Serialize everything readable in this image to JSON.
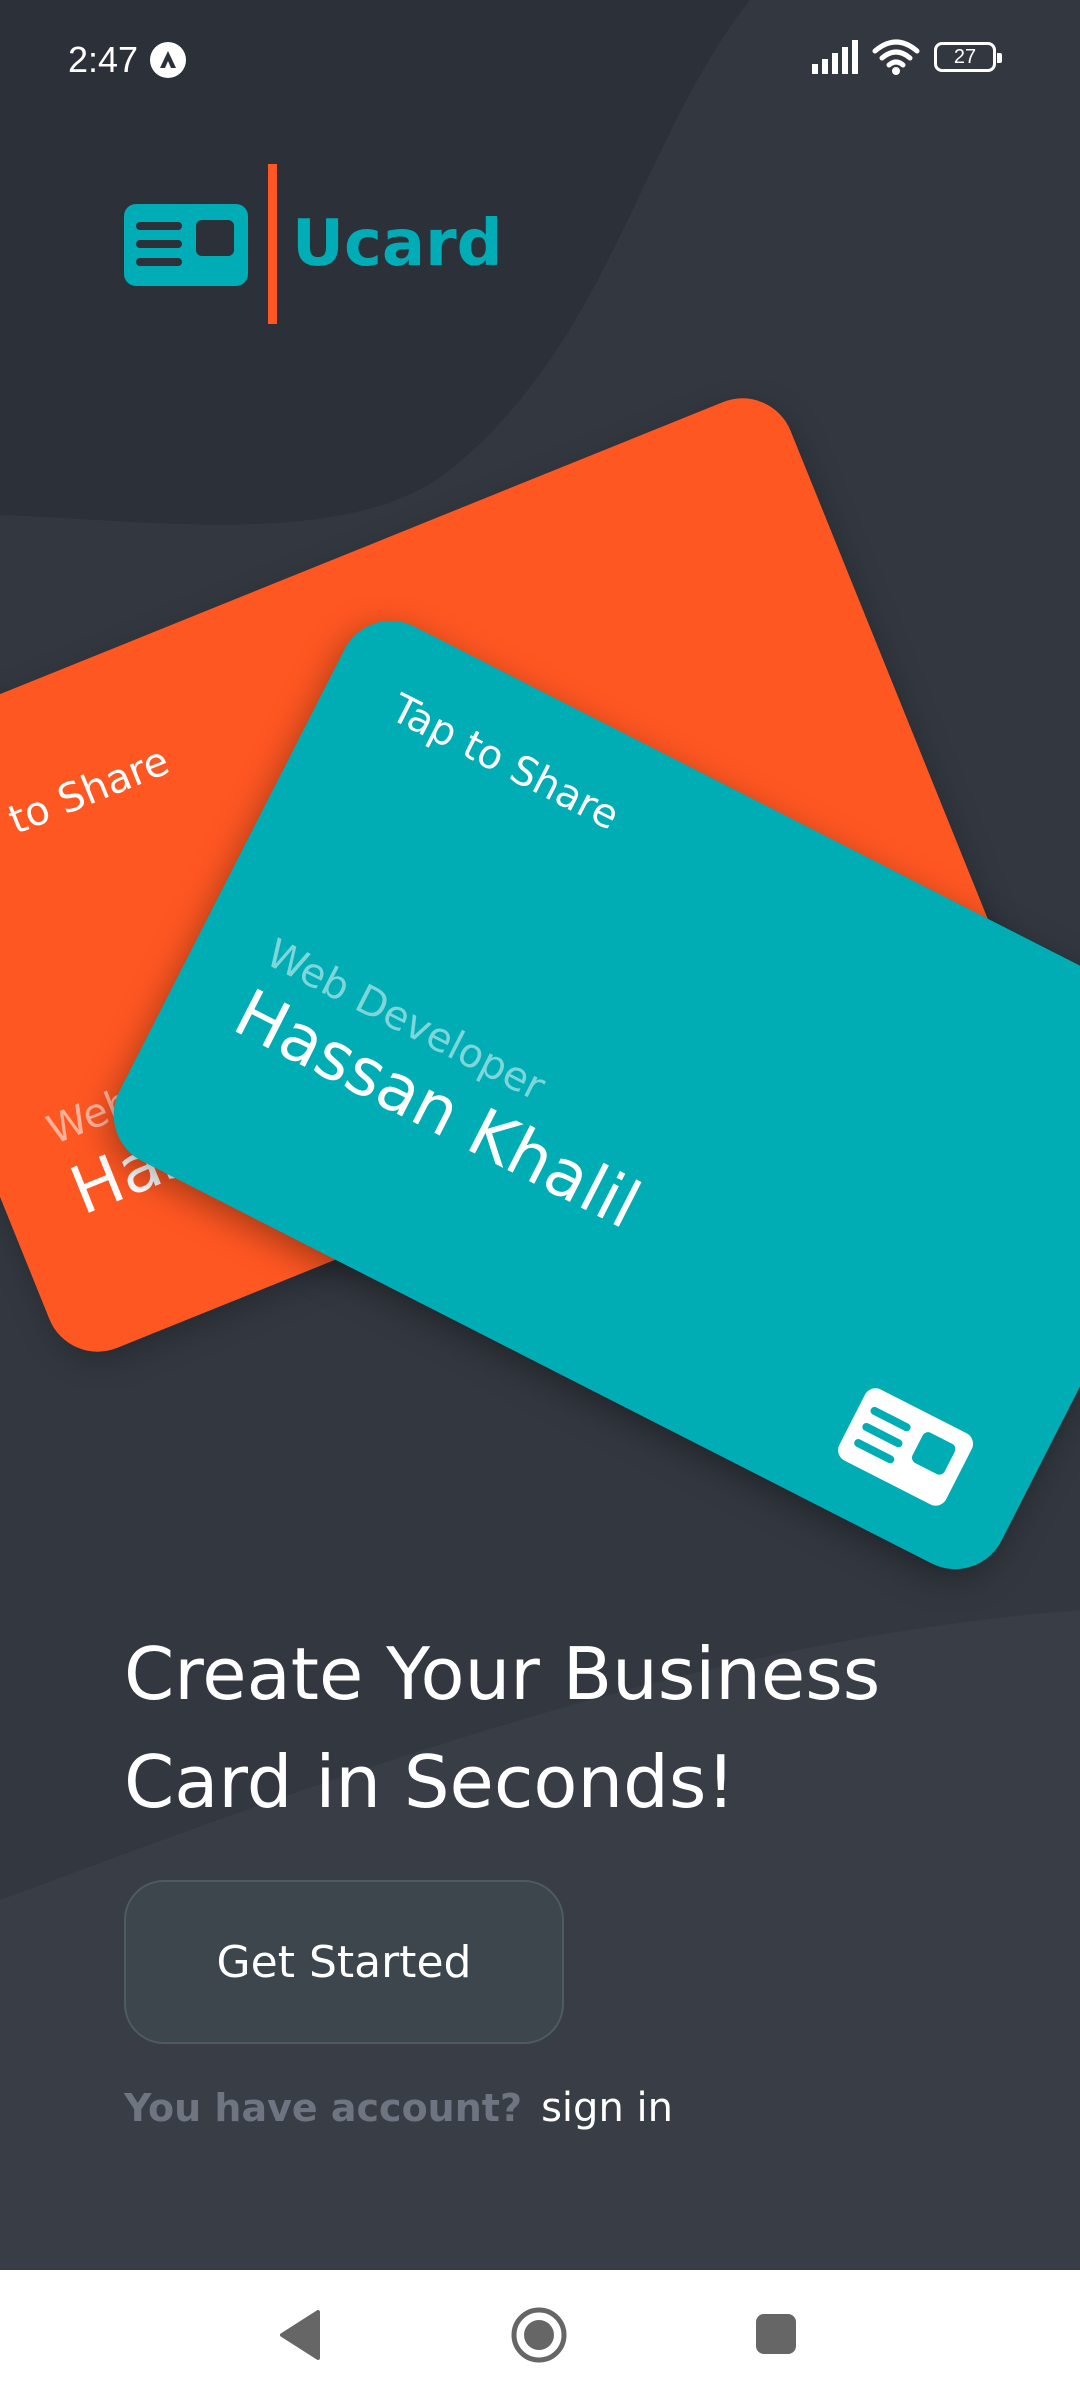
{
  "status_bar": {
    "time": "2:47",
    "notification_icon": "a-circle-icon",
    "signal_icon": "cellular-signal-icon",
    "wifi_icon": "wifi-icon",
    "battery_level": "27"
  },
  "brand": {
    "name": "Ucard",
    "logo_icon": "id-card-icon",
    "primary_color": "#00acb5",
    "accent_color": "#ff5722",
    "background_color": "#2c3038"
  },
  "cards": [
    {
      "color": "#ff5722",
      "share_text": "Tap to Share",
      "role": "Web Developer",
      "name": "Hassan Khalil"
    },
    {
      "color": "#00adb5",
      "share_text": "Tap to Share",
      "role": "Web Developer",
      "name": "Hassan Khalil"
    }
  ],
  "headline": "Create Your Business Card in Seconds!",
  "get_started_label": "Get Started",
  "signin": {
    "prompt": "You have account?",
    "link": "sign in"
  },
  "nav": {
    "back_icon": "back-triangle-icon",
    "home_icon": "home-circle-icon",
    "recents_icon": "recents-square-icon"
  }
}
